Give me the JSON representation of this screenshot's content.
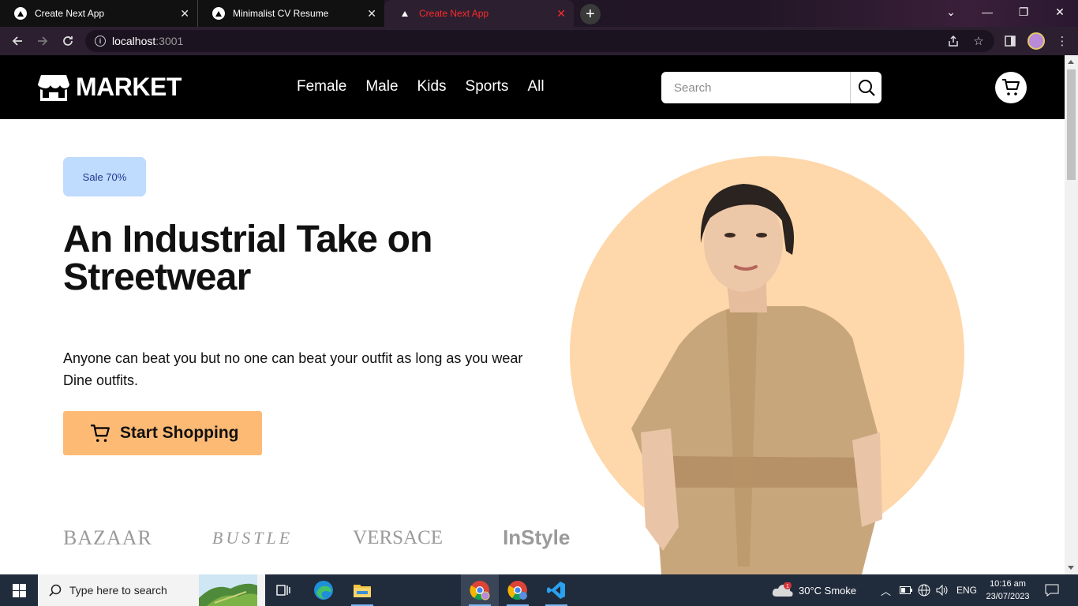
{
  "browser": {
    "tabs": [
      {
        "title": "Create Next App",
        "state": "inactive"
      },
      {
        "title": "Minimalist CV Resume",
        "state": "inactive"
      },
      {
        "title": "Create Next App",
        "state": "active"
      }
    ],
    "url_host": "localhost",
    "url_port": ":3001"
  },
  "site": {
    "logo_text": "MARKET",
    "nav": [
      "Female",
      "Male",
      "Kids",
      "Sports",
      "All"
    ],
    "search_placeholder": "Search"
  },
  "hero": {
    "badge": "Sale 70%",
    "headline": "An Industrial Take on Streetwear",
    "description": "Anyone can beat you but no one can beat your outfit as long as you wear Dine outfits.",
    "cta_label": "Start Shopping",
    "brands": [
      "BAZAAR",
      "BUSTLE",
      "VERSACE",
      "InStyle"
    ],
    "circle_color": "#fed7aa"
  },
  "taskbar": {
    "search_text": "Type here to search",
    "weather": "30°C  Smoke",
    "weather_badge": "1",
    "language": "ENG",
    "time": "10:16 am",
    "date": "23/07/2023"
  },
  "colors": {
    "accent_orange": "#fdba74",
    "badge_bg": "#bfdbfe",
    "badge_text": "#1e3a8a",
    "active_tab_text": "#ff2a2a"
  }
}
